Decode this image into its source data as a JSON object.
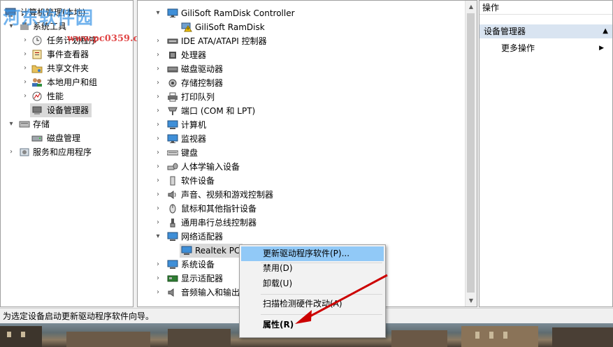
{
  "left_tree": {
    "items": [
      {
        "label": "计算机管理(本地)",
        "expander": "",
        "icon": "computer-mgmt-icon"
      },
      {
        "label": "系统工具",
        "expander": "▾",
        "icon": "tools-icon"
      },
      {
        "label": "任务计划程序",
        "expander": "›",
        "icon": "clock-icon"
      },
      {
        "label": "事件查看器",
        "expander": "›",
        "icon": "event-viewer-icon"
      },
      {
        "label": "共享文件夹",
        "expander": "›",
        "icon": "shared-folder-icon"
      },
      {
        "label": "本地用户和组",
        "expander": "›",
        "icon": "users-icon"
      },
      {
        "label": "性能",
        "expander": "›",
        "icon": "performance-icon"
      },
      {
        "label": "设备管理器",
        "expander": "",
        "icon": "device-manager-icon"
      },
      {
        "label": "存储",
        "expander": "▾",
        "icon": "storage-icon"
      },
      {
        "label": "磁盘管理",
        "expander": "",
        "icon": "disk-mgmt-icon"
      },
      {
        "label": "服务和应用程序",
        "expander": "›",
        "icon": "services-icon"
      }
    ]
  },
  "device_tree": {
    "items": [
      {
        "label": "GiliSoft RamDisk Controller",
        "expander": "▾",
        "icon": "monitor-icon"
      },
      {
        "label": "GiliSoft RamDisk",
        "expander": "",
        "icon": "warning-icon"
      },
      {
        "label": "IDE ATA/ATAPI 控制器",
        "expander": "›",
        "icon": "ide-controller-icon"
      },
      {
        "label": "处理器",
        "expander": "›",
        "icon": "processor-icon"
      },
      {
        "label": "磁盘驱动器",
        "expander": "›",
        "icon": "disk-drive-icon"
      },
      {
        "label": "存储控制器",
        "expander": "›",
        "icon": "storage-controller-icon"
      },
      {
        "label": "打印队列",
        "expander": "›",
        "icon": "printer-icon"
      },
      {
        "label": "端口 (COM 和 LPT)",
        "expander": "›",
        "icon": "port-icon"
      },
      {
        "label": "计算机",
        "expander": "›",
        "icon": "computer-icon"
      },
      {
        "label": "监视器",
        "expander": "›",
        "icon": "monitor-icon"
      },
      {
        "label": "键盘",
        "expander": "›",
        "icon": "keyboard-icon"
      },
      {
        "label": "人体学输入设备",
        "expander": "›",
        "icon": "hid-icon"
      },
      {
        "label": "软件设备",
        "expander": "›",
        "icon": "software-device-icon"
      },
      {
        "label": "声音、视频和游戏控制器",
        "expander": "›",
        "icon": "speaker-icon"
      },
      {
        "label": "鼠标和其他指针设备",
        "expander": "›",
        "icon": "mouse-icon"
      },
      {
        "label": "通用串行总线控制器",
        "expander": "›",
        "icon": "usb-icon"
      },
      {
        "label": "网络适配器",
        "expander": "▾",
        "icon": "network-adapter-icon"
      },
      {
        "label": "Realtek PC",
        "expander": "",
        "icon": "network-card-icon"
      },
      {
        "label": "系统设备",
        "expander": "›",
        "icon": "system-device-icon"
      },
      {
        "label": "显示适配器",
        "expander": "›",
        "icon": "display-adapter-icon"
      },
      {
        "label": "音频输入和输出",
        "expander": "›",
        "icon": "audio-io-icon"
      }
    ]
  },
  "actions_pane": {
    "title": "操作",
    "section": "设备管理器",
    "more": "更多操作"
  },
  "context_menu": {
    "update_driver": "更新驱动程序软件(P)...",
    "disable": "禁用(D)",
    "uninstall": "卸载(U)",
    "scan": "扫描检测硬件改动(A)",
    "properties": "属性(R)"
  },
  "status_bar": {
    "text": "为选定设备启动更新驱动程序软件向导。"
  },
  "watermark": {
    "text": "河东软件园",
    "url": "www.pc0359.cn"
  },
  "colors": {
    "menu_highlight": "#91c9f7",
    "tree_selection": "#d9d9d9",
    "actions_section": "#d9e4f1",
    "annotation_arrow": "#cc0000"
  }
}
